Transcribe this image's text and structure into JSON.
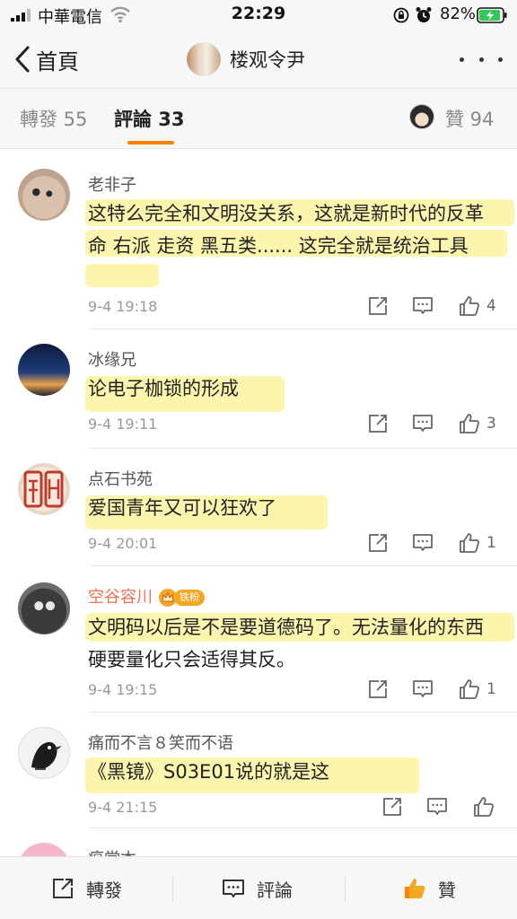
{
  "status_bar": {
    "carrier": "中華電信",
    "time": "22:29",
    "battery": "82%"
  },
  "nav": {
    "back_label": "首頁",
    "title": "楼观令尹"
  },
  "tabs": {
    "repost": "轉發 55",
    "comments": "評論 33",
    "likes": "贊 94"
  },
  "comments": [
    {
      "name": "老非子",
      "text": "这特么完全和文明没关系，这就是新时代的反革命 右派 走资 黑五类...... 这完全就是统治工具",
      "time": "9-4 19:18",
      "likes": "4"
    },
    {
      "name": "冰缘兄",
      "text": "论电子枷锁的形成",
      "time": "9-4 19:11",
      "likes": "3"
    },
    {
      "name": "点石书苑",
      "text": "爱国青年又可以狂欢了",
      "time": "9-4 20:01",
      "likes": "1"
    },
    {
      "name": "空谷容川",
      "badge": "铁粉",
      "text": "文明码以后是不是要道德码了。无法量化的东西硬要量化只会适得其反。",
      "time": "9-4 19:15",
      "likes": "1"
    },
    {
      "name": "痛而不言８笑而不语",
      "text": "《黑镜》S03E01说的就是这",
      "time": "9-4 21:15",
      "likes": ""
    },
    {
      "name": "瘟堂本"
    }
  ],
  "bottom_bar": {
    "repost": "轉發",
    "comment": "評論",
    "like": "贊"
  },
  "colors": {
    "accent": "#ff8200",
    "vip_name": "#eb7350",
    "highlight": "#fcf3a0"
  }
}
